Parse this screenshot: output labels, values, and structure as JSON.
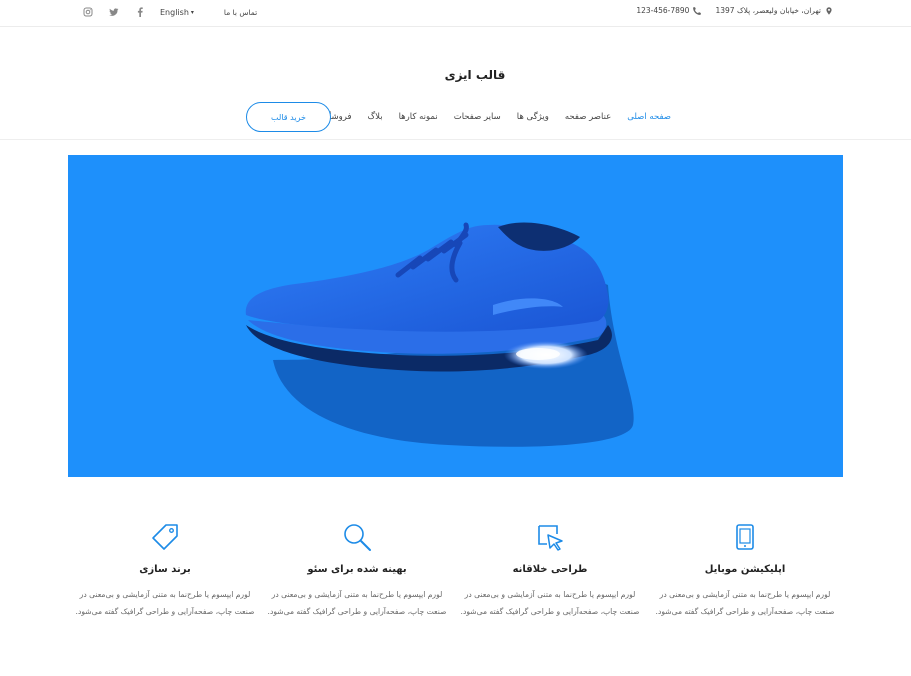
{
  "topbar": {
    "language": "English",
    "contact": "تماس با ما",
    "phone": "123-456-7890",
    "address": "تهران، خیابان ولیعصر، پلاک 1397",
    "social": [
      "instagram-icon",
      "twitter-icon",
      "facebook-icon"
    ]
  },
  "header": {
    "logo": "قالب ایزی",
    "buy_button": "خرید قالب",
    "nav": [
      {
        "label": "صفحه اصلی",
        "active": true
      },
      {
        "label": "عناصر صفحه",
        "active": false
      },
      {
        "label": "ویژگی ها",
        "active": false
      },
      {
        "label": "سایر صفحات",
        "active": false
      },
      {
        "label": "نمونه کارها",
        "active": false
      },
      {
        "label": "بلاگ",
        "active": false
      },
      {
        "label": "فروشگاه",
        "active": false
      }
    ]
  },
  "hero": {
    "background": "#1e90fb",
    "subject": "blue sneaker"
  },
  "accent_color": "#1d8be7",
  "features": [
    {
      "icon": "tablet-icon",
      "title": "اپلیکیشن موبایل",
      "desc": "لورم ایپسوم یا طرح‌نما به متنی آزمایشی و بی‌معنی در صنعت چاپ، صفحه‌آرایی و طراحی گرافیک گفته می‌شود."
    },
    {
      "icon": "cursor-icon",
      "title": "طراحی خلاقانه",
      "desc": "لورم ایپسوم یا طرح‌نما به متنی آزمایشی و بی‌معنی در صنعت چاپ، صفحه‌آرایی و طراحی گرافیک گفته می‌شود."
    },
    {
      "icon": "search-icon",
      "title": "بهینه شده برای سئو",
      "desc": "لورم ایپسوم یا طرح‌نما به متنی آزمایشی و بی‌معنی در صنعت چاپ، صفحه‌آرایی و طراحی گرافیک گفته می‌شود."
    },
    {
      "icon": "tag-icon",
      "title": "برند سازی",
      "desc": "لورم ایپسوم یا طرح‌نما به متنی آزمایشی و بی‌معنی در صنعت چاپ، صفحه‌آرایی و طراحی گرافیک گفته می‌شود."
    }
  ]
}
